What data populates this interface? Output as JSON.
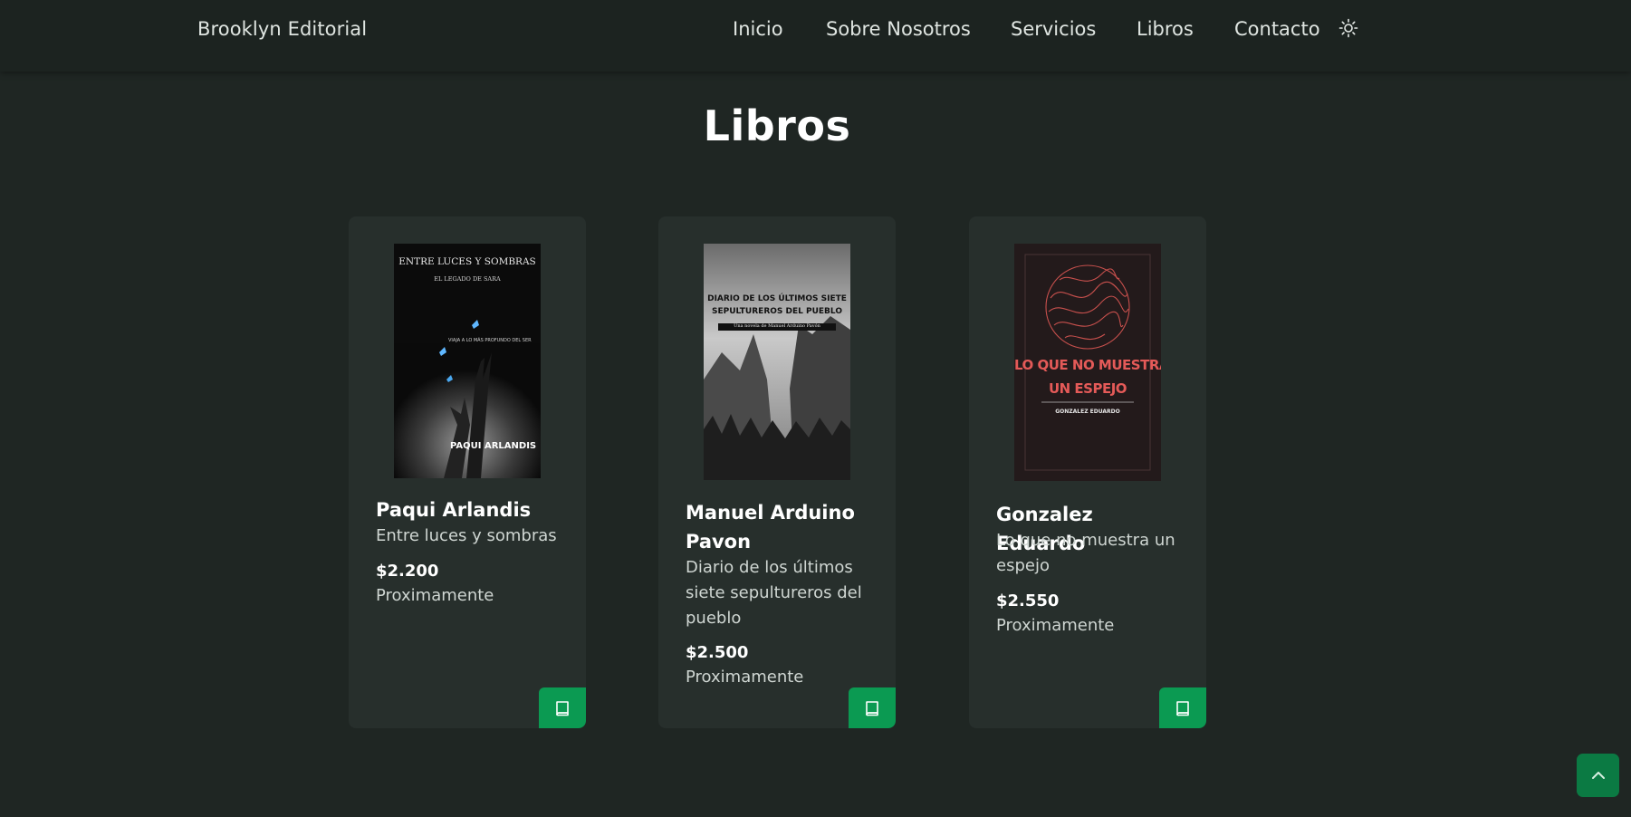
{
  "brand": "Brooklyn Editorial",
  "nav": {
    "items": [
      "Inicio",
      "Sobre Nosotros",
      "Servicios",
      "Libros",
      "Contacto"
    ],
    "theme_icon": "sun-icon"
  },
  "page_title": "Libros",
  "books": [
    {
      "author": "Paqui Arlandis",
      "title": "Entre luces y sombras",
      "price": "$2.200",
      "status": "Proximamente",
      "cover": {
        "title": "ENTRE LUCES Y SOMBRAS",
        "subtitle": "EL LEGADO DE SARA",
        "tagline": "VIAJA A LO MÁS PROFUNDO DEL SER",
        "author": "PAQUI ARLANDIS"
      }
    },
    {
      "author": "Manuel Arduino Pavon",
      "title": "Diario de los últimos siete sepultureros del pueblo",
      "price": "$2.500",
      "status": "Proximamente",
      "cover": {
        "title_line1": "DIARIO DE LOS ÚLTIMOS SIETE",
        "title_line2": "SEPULTUREROS DEL PUEBLO",
        "byline": "Una novela de Manuel Arduino Pavón"
      }
    },
    {
      "author": "Gonzalez Eduardo",
      "title": "Lo que no muestra un espejo",
      "price": "$2.550",
      "status": "Proximamente",
      "cover": {
        "title_line1": "LO QUE NO MUESTRA",
        "title_line2": "UN ESPEJO",
        "author": "GONZALEZ EDUARDO"
      }
    }
  ],
  "icons": {
    "book_button": "book-icon",
    "scroll_top": "chevron-up-icon"
  },
  "colors": {
    "background": "#1f2623",
    "card": "#272f2c",
    "accent": "#0b9a52"
  }
}
